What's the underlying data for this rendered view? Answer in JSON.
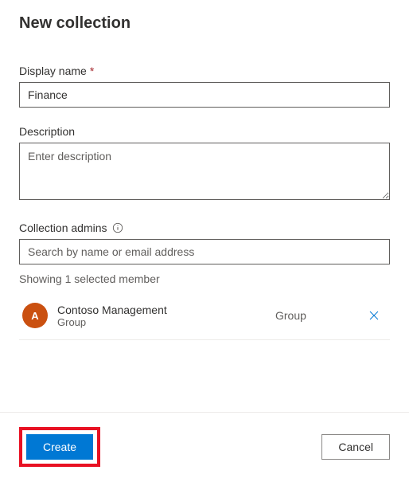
{
  "title": "New collection",
  "fields": {
    "displayName": {
      "label": "Display name",
      "required": "*",
      "value": "Finance"
    },
    "description": {
      "label": "Description",
      "placeholder": "Enter description",
      "value": ""
    },
    "admins": {
      "label": "Collection admins",
      "placeholder": "Search by name or email address",
      "value": "",
      "status": "Showing 1 selected member"
    }
  },
  "members": [
    {
      "initial": "A",
      "name": "Contoso Management",
      "sub": "Group",
      "type": "Group"
    }
  ],
  "buttons": {
    "create": "Create",
    "cancel": "Cancel"
  }
}
